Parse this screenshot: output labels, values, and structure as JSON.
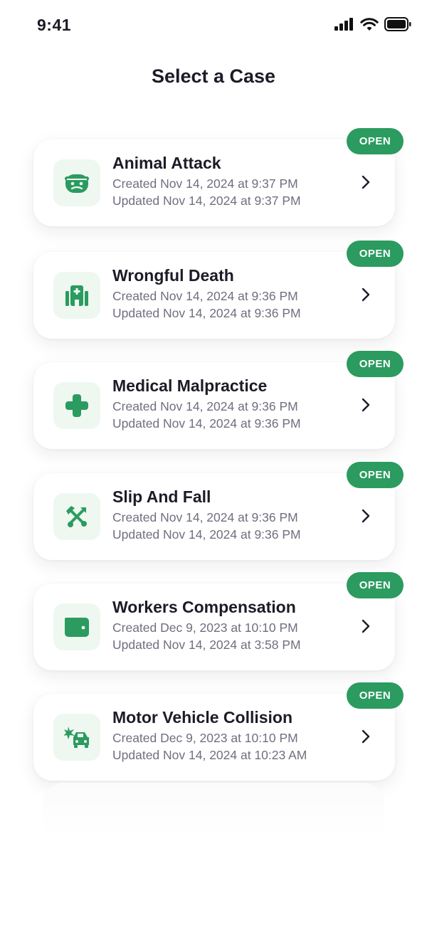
{
  "status_bar": {
    "time": "9:41"
  },
  "page_title": "Select a Case",
  "colors": {
    "accent": "#2b9b5f",
    "icon_bg": "#eef8f1",
    "text_primary": "#1c1c28",
    "text_secondary": "#6f6f80"
  },
  "cases": [
    {
      "title": "Animal Attack",
      "created": "Created Nov 14, 2024 at 9:37 PM",
      "updated": "Updated Nov 14, 2024 at 9:37 PM",
      "status": "OPEN",
      "icon": "animal-face-icon"
    },
    {
      "title": "Wrongful Death",
      "created": "Created Nov 14, 2024 at 9:36 PM",
      "updated": "Updated Nov 14, 2024 at 9:36 PM",
      "status": "OPEN",
      "icon": "hospital-icon"
    },
    {
      "title": "Medical Malpractice",
      "created": "Created Nov 14, 2024 at 9:36 PM",
      "updated": "Updated Nov 14, 2024 at 9:36 PM",
      "status": "OPEN",
      "icon": "medical-cross-icon"
    },
    {
      "title": "Slip And Fall",
      "created": "Created Nov 14, 2024 at 9:36 PM",
      "updated": "Updated Nov 14, 2024 at 9:36 PM",
      "status": "OPEN",
      "icon": "crossed-tools-icon"
    },
    {
      "title": "Workers Compensation",
      "created": "Created Dec 9, 2023 at 10:10 PM",
      "updated": "Updated Nov 14, 2024 at 3:58 PM",
      "status": "OPEN",
      "icon": "wallet-icon"
    },
    {
      "title": "Motor Vehicle Collision",
      "created": "Created Dec 9, 2023 at 10:10 PM",
      "updated": "Updated Nov 14, 2024 at 10:23 AM",
      "status": "OPEN",
      "icon": "car-crash-icon"
    }
  ]
}
